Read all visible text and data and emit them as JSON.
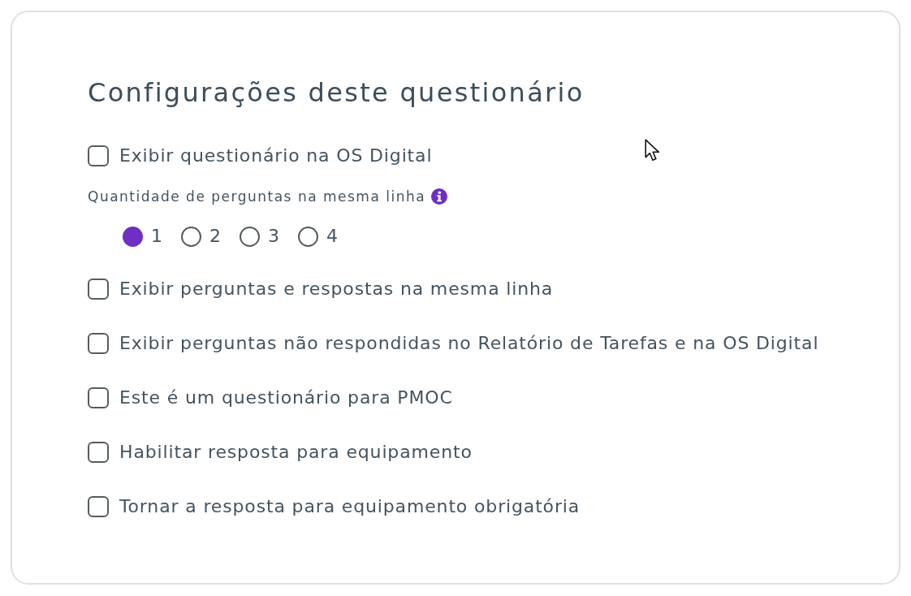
{
  "title": "Configurações deste questionário",
  "options": [
    {
      "kind": "checkbox",
      "label": "Exibir questionário na OS Digital",
      "checked": false
    },
    {
      "kind": "radio-group",
      "label": "Quantidade de perguntas na mesma linha",
      "choices": [
        {
          "label": "1",
          "selected": true
        },
        {
          "label": "2",
          "selected": false
        },
        {
          "label": "3",
          "selected": false
        },
        {
          "label": "4",
          "selected": false
        }
      ]
    },
    {
      "kind": "checkbox",
      "label": "Exibir perguntas e respostas na mesma linha",
      "checked": false
    },
    {
      "kind": "checkbox",
      "label": "Exibir perguntas não respondidas no Relatório de Tarefas e na OS Digital",
      "checked": false
    },
    {
      "kind": "checkbox",
      "label": "Este é um questionário para PMOC",
      "checked": false
    },
    {
      "kind": "checkbox",
      "label": "Habilitar resposta para equipamento",
      "checked": false
    },
    {
      "kind": "checkbox",
      "label": "Tornar a resposta para equipamento obrigatória",
      "checked": false
    }
  ]
}
